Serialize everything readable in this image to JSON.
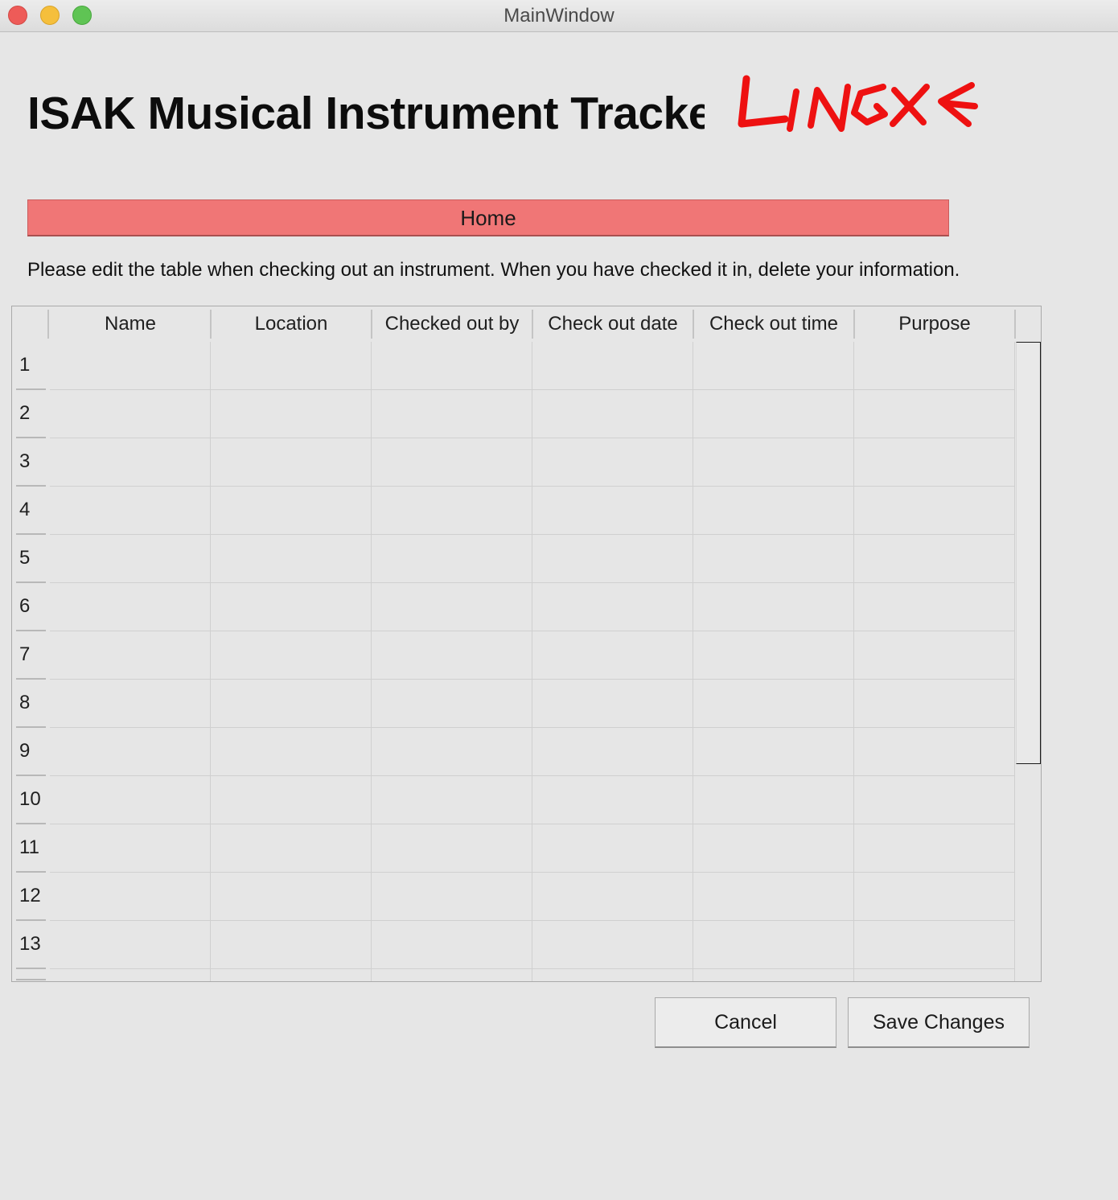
{
  "window": {
    "title": "MainWindow"
  },
  "header": {
    "title": "ISAK Musical Instrument Tracker",
    "logo_text": "LINGXE",
    "logo_color": "#ee1111"
  },
  "nav": {
    "home_label": "Home",
    "home_color": "#f07676"
  },
  "instructions": "Please edit the table when checking out an instrument. When you have checked it in, delete your information.",
  "table": {
    "columns": [
      "Name",
      "Location",
      "Checked out by",
      "Check out date",
      "Check out time",
      "Purpose"
    ],
    "row_numbers": [
      "1",
      "2",
      "3",
      "4",
      "5",
      "6",
      "7",
      "8",
      "9",
      "10",
      "11",
      "12",
      "13"
    ],
    "rows": [
      [
        "",
        "",
        "",
        "",
        "",
        ""
      ],
      [
        "",
        "",
        "",
        "",
        "",
        ""
      ],
      [
        "",
        "",
        "",
        "",
        "",
        ""
      ],
      [
        "",
        "",
        "",
        "",
        "",
        ""
      ],
      [
        "",
        "",
        "",
        "",
        "",
        ""
      ],
      [
        "",
        "",
        "",
        "",
        "",
        ""
      ],
      [
        "",
        "",
        "",
        "",
        "",
        ""
      ],
      [
        "",
        "",
        "",
        "",
        "",
        ""
      ],
      [
        "",
        "",
        "",
        "",
        "",
        ""
      ],
      [
        "",
        "",
        "",
        "",
        "",
        ""
      ],
      [
        "",
        "",
        "",
        "",
        "",
        ""
      ],
      [
        "",
        "",
        "",
        "",
        "",
        ""
      ],
      [
        "",
        "",
        "",
        "",
        "",
        ""
      ]
    ]
  },
  "actions": {
    "cancel_label": "Cancel",
    "save_label": "Save Changes"
  }
}
